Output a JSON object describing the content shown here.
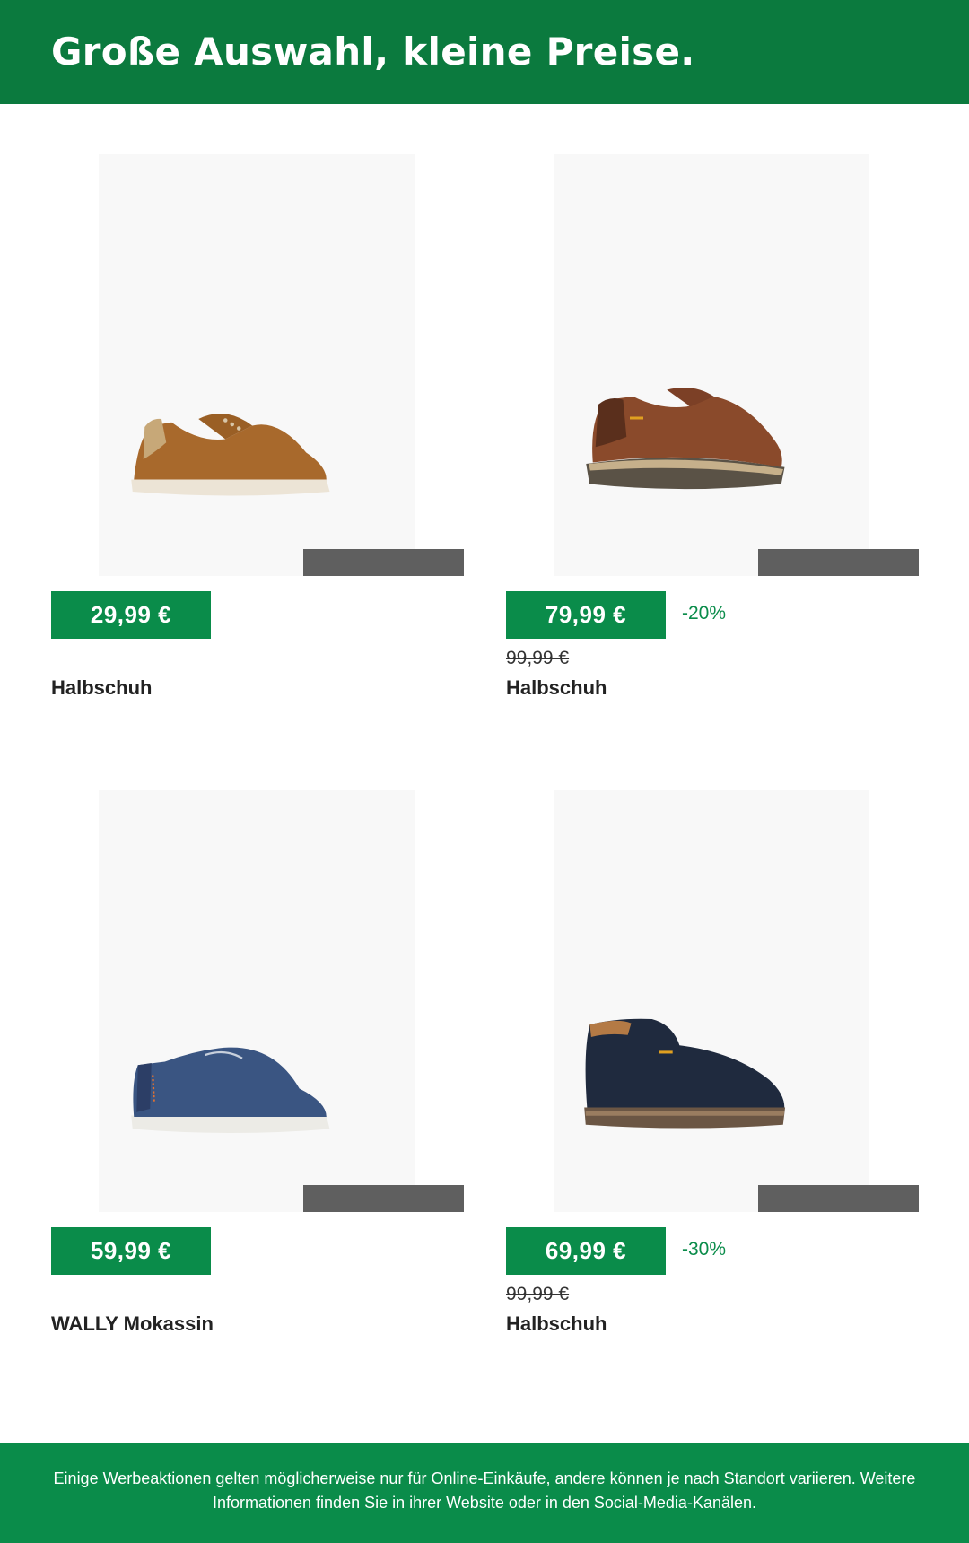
{
  "header": {
    "title": "Große Auswahl, kleine Preise."
  },
  "products": [
    {
      "price": "29,99 €",
      "discount": "",
      "old_price": "",
      "name": "Halbschuh",
      "icon": "tan-suede-sneaker-image"
    },
    {
      "price": "79,99 €",
      "discount": "-20%",
      "old_price": "99,99 €",
      "name": "Halbschuh",
      "icon": "brown-leather-walking-shoe-image"
    },
    {
      "price": "59,99 €",
      "discount": "",
      "old_price": "",
      "name": "WALLY Mokassin",
      "icon": "blue-mesh-moccasin-image"
    },
    {
      "price": "69,99 €",
      "discount": "-30%",
      "old_price": "99,99 €",
      "name": "Halbschuh",
      "icon": "navy-suede-chukka-image"
    }
  ],
  "footer": {
    "text": "Einige Werbeaktionen gelten möglicherweise nur für Online-Einkäufe, andere können je nach Standort variieren. Weitere Informationen finden Sie in ihrer Website oder in den Social-Media-Kanälen."
  },
  "colors": {
    "brand_green": "#0b7a3e",
    "badge_green": "#0a8c4a",
    "overlay_gray": "#5f5f5f"
  }
}
